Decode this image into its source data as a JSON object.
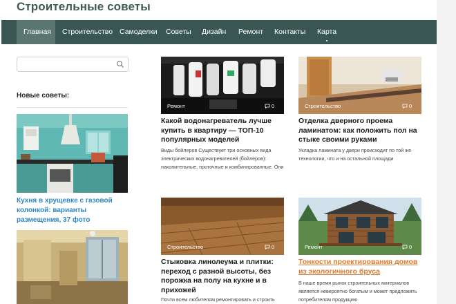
{
  "site": {
    "title": "Строительные советы"
  },
  "nav": {
    "items": [
      {
        "label": "Главная",
        "active": true
      },
      {
        "label": "Строительство"
      },
      {
        "label": "Самоделки"
      },
      {
        "label": "Советы"
      },
      {
        "label": "Дизайн"
      },
      {
        "label": "Ремонт"
      },
      {
        "label": "Контакты"
      },
      {
        "label": "Карта"
      }
    ]
  },
  "sidebar": {
    "search": {
      "value": "",
      "placeholder": "",
      "icon": "search-icon"
    },
    "widget_title": "Новые советы:",
    "posts": [
      {
        "title": "Кухня в хрущевке с газовой колонкой: варианты размещения, 37 фото"
      },
      {
        "title": ""
      }
    ]
  },
  "cards": [
    {
      "category": "Ремонт",
      "comments": "0",
      "title": "Какой водонагреватель лучше купить в квартиру — ТОП-10 популярных моделей",
      "excerpt": "Виды бойлеров Существует три основных вида электрических водонагревателей (бойлеров): накопительные, проточные и комбинированные. Они"
    },
    {
      "category": "Строительство",
      "comments": "0",
      "title": "Отделка дверного проема ламинатом: как положить пол на стыке своими руками",
      "excerpt": "Укладка ламината у двери происходит по той же технологии, что и на остальной площади"
    },
    {
      "category": "Строительство",
      "comments": "0",
      "title": "Стыковка линолеума и плитки: переход с разной высоты, без порожка на полу на кухне и в прихожей",
      "excerpt": "Почти всем любителям ремонтировать и строить"
    },
    {
      "category": "Ремонт",
      "comments": "0",
      "title": "Тонкости проектирования домов из экологичного бруса",
      "highlight": true,
      "excerpt": "В наше время рынок строительных материалов является невероятно богатым и может предложить потребителям продукцию"
    }
  ],
  "colors": {
    "nav_bg": "#3a5652",
    "nav_active": "#5b7571",
    "link_blue": "#2f86c4",
    "accent_orange": "#e07b2e",
    "title_green": "#3f5a55"
  }
}
